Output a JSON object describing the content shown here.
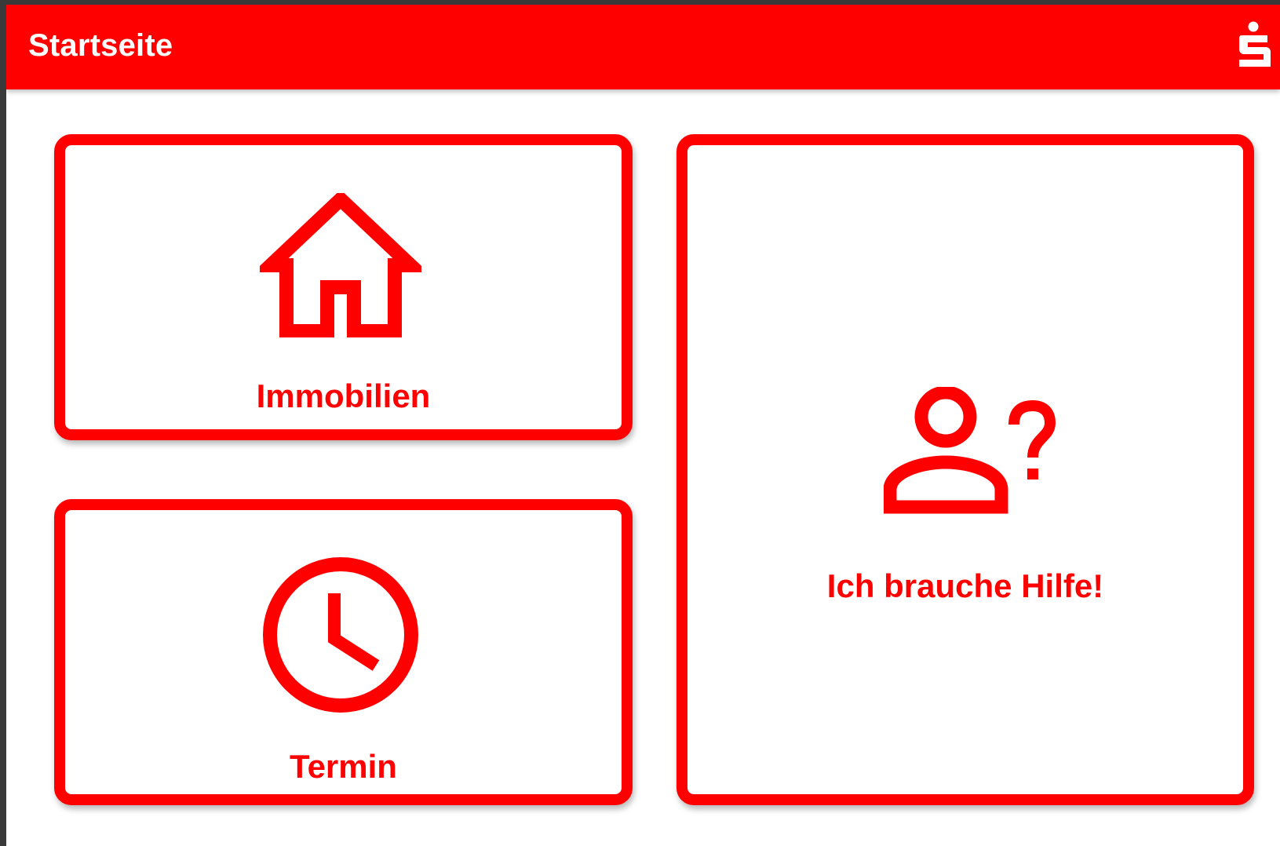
{
  "appbar": {
    "title": "Startseite",
    "logo_icon": "sparkasse-s-logo-icon"
  },
  "tiles": [
    {
      "label": "Immobilien",
      "icon": "house-icon"
    },
    {
      "label": "Termin",
      "icon": "clock-icon"
    },
    {
      "label": "Ich brauche Hilfe!",
      "icon": "person-question-icon"
    }
  ],
  "colors": {
    "brand": "#ff0000",
    "surface": "#ffffff",
    "frame": "#3a3a3a"
  }
}
